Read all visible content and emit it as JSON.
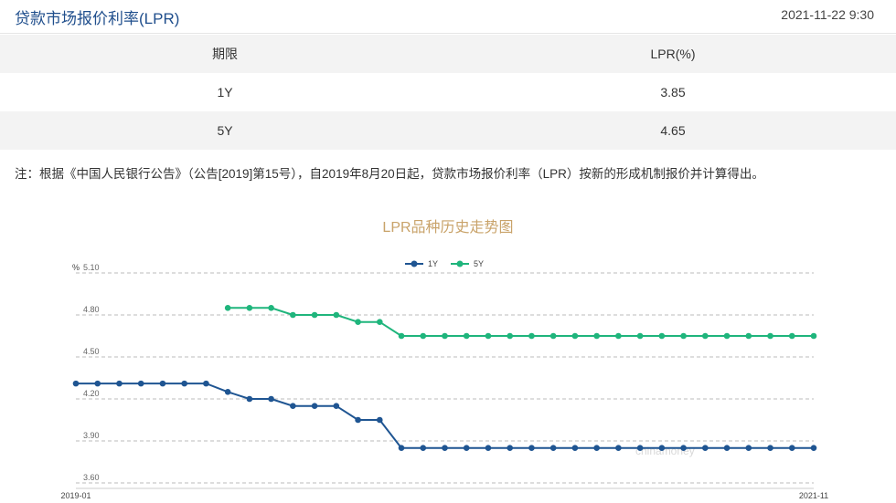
{
  "header": {
    "title": "贷款市场报价利率(LPR)",
    "date": "2021-11-22 9:30"
  },
  "table": {
    "headers": [
      "期限",
      "LPR(%)"
    ],
    "rows": [
      [
        "1Y",
        "3.85"
      ],
      [
        "5Y",
        "4.65"
      ]
    ]
  },
  "note": "注：根据《中国人民银行公告》（公告[2019]第15号），自2019年8月20日起，贷款市场报价利率（LPR）按新的形成机制报价并计算得出。",
  "watermark": "chinamoney",
  "colors": {
    "series_1y": "#1f5592",
    "series_5y": "#1fb57c",
    "title": "#c9a36a",
    "grid": "#bbbbbb"
  },
  "chart_data": {
    "type": "line",
    "title": "LPR品种历史走势图",
    "ylabel": "%",
    "ylim": [
      3.6,
      5.1
    ],
    "yticks": [
      "5.10",
      "4.80",
      "4.50",
      "4.20",
      "3.90",
      "3.60"
    ],
    "xticks": [
      "2019-01",
      "2021-11"
    ],
    "grid": true,
    "legend": "top-center",
    "series": [
      {
        "name": "1Y",
        "values": [
          4.31,
          4.31,
          4.31,
          4.31,
          4.31,
          4.31,
          4.31,
          4.25,
          4.2,
          4.2,
          4.15,
          4.15,
          4.15,
          4.05,
          4.05,
          3.85,
          3.85,
          3.85,
          3.85,
          3.85,
          3.85,
          3.85,
          3.85,
          3.85,
          3.85,
          3.85,
          3.85,
          3.85,
          3.85,
          3.85,
          3.85,
          3.85,
          3.85,
          3.85,
          3.85
        ]
      },
      {
        "name": "5Y",
        "values": [
          null,
          null,
          null,
          null,
          null,
          null,
          null,
          4.85,
          4.85,
          4.85,
          4.8,
          4.8,
          4.8,
          4.75,
          4.75,
          4.65,
          4.65,
          4.65,
          4.65,
          4.65,
          4.65,
          4.65,
          4.65,
          4.65,
          4.65,
          4.65,
          4.65,
          4.65,
          4.65,
          4.65,
          4.65,
          4.65,
          4.65,
          4.65,
          4.65
        ]
      }
    ]
  }
}
